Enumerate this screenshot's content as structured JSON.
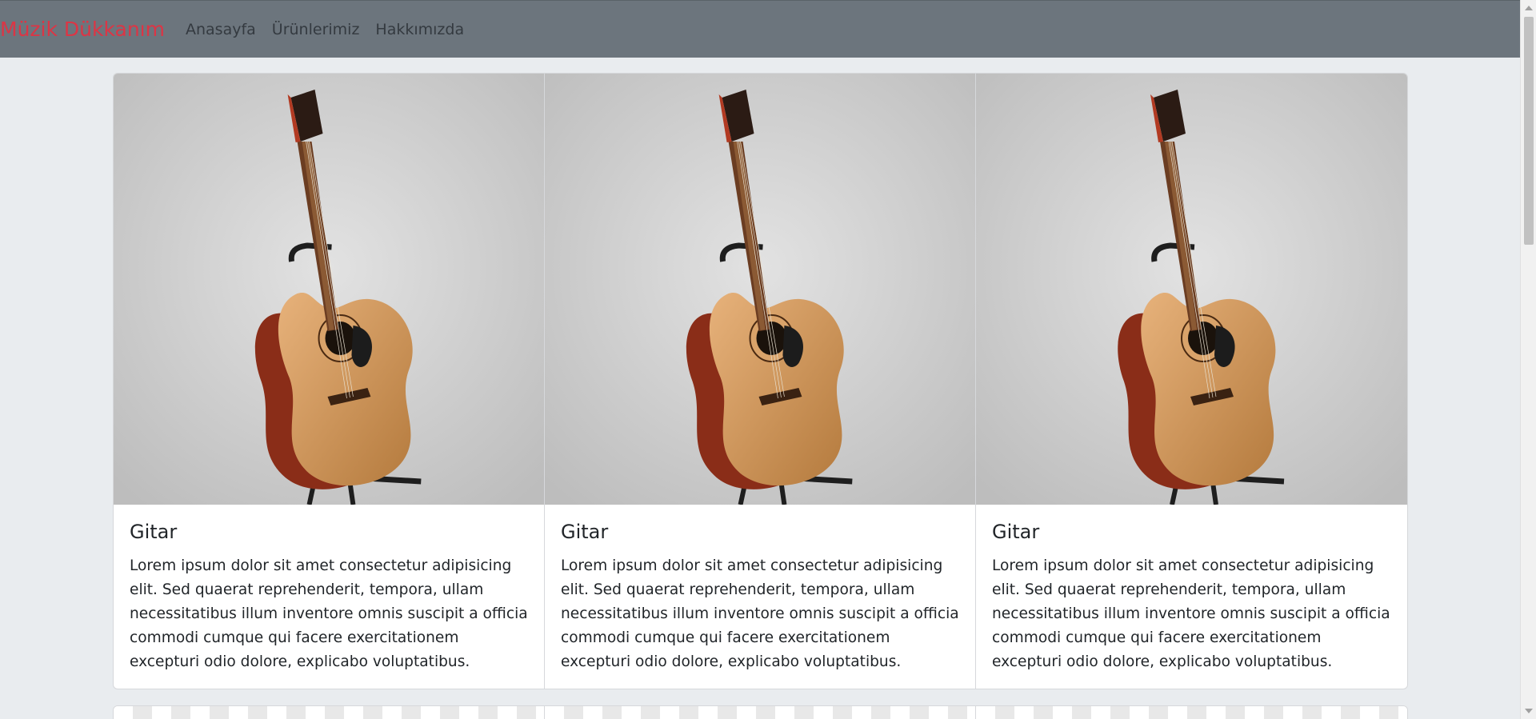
{
  "navbar": {
    "brand": "Müzik Dükkanım",
    "links": [
      "Anasayfa",
      "Ürünlerimiz",
      "Hakkımızda"
    ],
    "brand_color": "#dc3545",
    "background": "#6c757d"
  },
  "cards": [
    {
      "title": "Gitar",
      "text": "Lorem ipsum dolor sit amet consectetur adipisicing elit. Sed quaerat reprehenderit, tempora, ullam necessitatibus illum inventore omnis suscipit a officia commodi cumque qui facere exercitationem excepturi odio dolore, explicabo voluptatibus.",
      "image": "acoustic-guitar-image"
    },
    {
      "title": "Gitar",
      "text": "Lorem ipsum dolor sit amet consectetur adipisicing elit. Sed quaerat reprehenderit, tempora, ullam necessitatibus illum inventore omnis suscipit a officia commodi cumque qui facere exercitationem excepturi odio dolore, explicabo voluptatibus.",
      "image": "acoustic-guitar-image"
    },
    {
      "title": "Gitar",
      "text": "Lorem ipsum dolor sit amet consectetur adipisicing elit. Sed quaerat reprehenderit, tempora, ullam necessitatibus illum inventore omnis suscipit a officia commodi cumque qui facere exercitationem excepturi odio dolore, explicabo voluptatibus.",
      "image": "acoustic-guitar-image"
    }
  ]
}
